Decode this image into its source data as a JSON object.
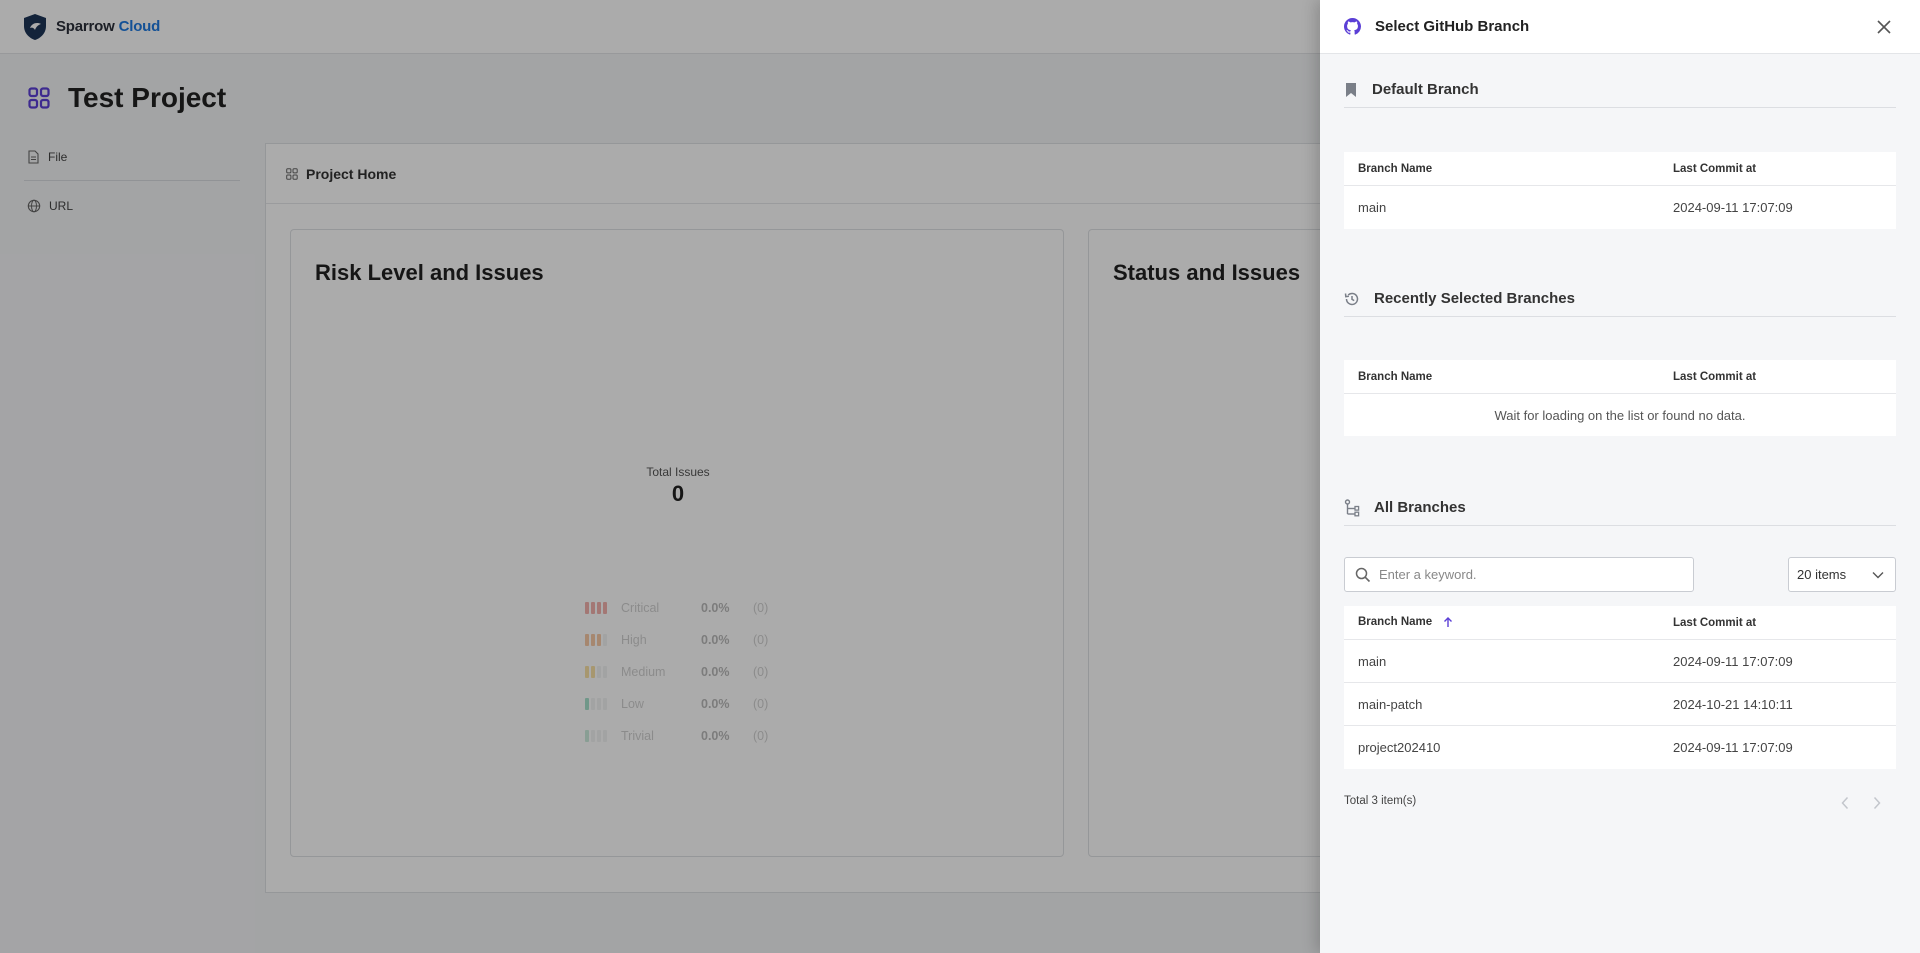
{
  "app": {
    "brand_word1": "Sparrow",
    "brand_word2": "Cloud",
    "project_title": "Test Project"
  },
  "sidebar": {
    "items": [
      {
        "label": "File",
        "icon": "file-icon"
      },
      {
        "label": "URL",
        "icon": "globe-icon"
      }
    ]
  },
  "main": {
    "card_title": "Project Home",
    "risk_panel": {
      "title": "Risk Level and Issues",
      "total_label": "Total Issues",
      "total_value": "0",
      "legend": [
        {
          "name": "Critical",
          "pct": "0.0%",
          "count": "(0)",
          "color": "#e8574e",
          "level": 4
        },
        {
          "name": "High",
          "pct": "0.0%",
          "count": "(0)",
          "color": "#f08a3c",
          "level": 3
        },
        {
          "name": "Medium",
          "pct": "0.0%",
          "count": "(0)",
          "color": "#f2c13b",
          "level": 2
        },
        {
          "name": "Low",
          "pct": "0.0%",
          "count": "(0)",
          "color": "#3fbf8f",
          "level": 1
        },
        {
          "name": "Trivial",
          "pct": "0.0%",
          "count": "(0)",
          "color": "#8fd6b5",
          "level": 0
        }
      ]
    },
    "status_panel": {
      "title": "Status and Issues"
    }
  },
  "drawer": {
    "title": "Select GitHub Branch",
    "default_section": {
      "title": "Default Branch",
      "col1": "Branch Name",
      "col2": "Last Commit at",
      "rows": [
        {
          "name": "main",
          "commit": "2024-09-11 17:07:09"
        }
      ]
    },
    "recent_section": {
      "title": "Recently Selected Branches",
      "col1": "Branch Name",
      "col2": "Last Commit at",
      "empty_text": "Wait for loading on the list or found no data."
    },
    "all_section": {
      "title": "All Branches",
      "search_placeholder": "Enter a keyword.",
      "page_size": "20 items",
      "col1": "Branch Name",
      "col2": "Last Commit at",
      "rows": [
        {
          "name": "main",
          "commit": "2024-09-11 17:07:09"
        },
        {
          "name": "main-patch",
          "commit": "2024-10-21 14:10:11"
        },
        {
          "name": "project202410",
          "commit": "2024-09-11 17:07:09"
        }
      ],
      "total_text": "Total 3 item(s)"
    }
  },
  "colors": {
    "accent": "#5b3fd6",
    "brand_blue": "#1f7ae0"
  }
}
